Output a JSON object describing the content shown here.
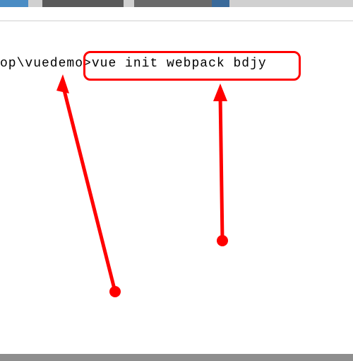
{
  "terminal": {
    "path_fragment": "op\\vuedemo",
    "prompt_symbol": ">",
    "command": "vue init webpack bdjy"
  },
  "annotations": {
    "highlight": "command-highlight",
    "arrows": [
      "arrow-to-path",
      "arrow-to-command"
    ]
  }
}
